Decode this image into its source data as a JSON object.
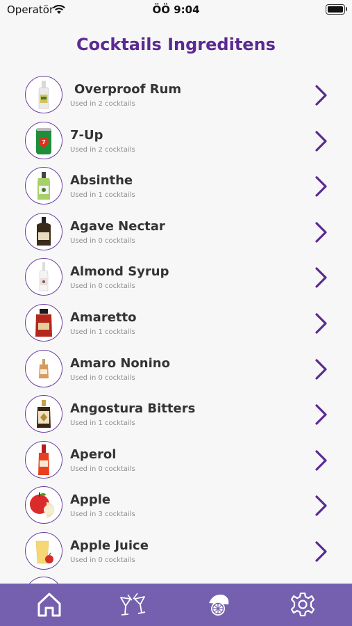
{
  "status_bar": {
    "carrier": "Operatör",
    "time": "ÖÖ 9:04"
  },
  "page": {
    "title": "Cocktails Ingreditens"
  },
  "ingredients": [
    {
      "name": " Overproof Rum",
      "usage": "Used in 2 cocktails",
      "icon": "rum-bottle-icon"
    },
    {
      "name": "7-Up",
      "usage": "Used in 2 cocktails",
      "icon": "soda-can-icon"
    },
    {
      "name": "Absinthe",
      "usage": "Used in 1 cocktails",
      "icon": "absinthe-bottle-icon"
    },
    {
      "name": "Agave Nectar",
      "usage": "Used in 0 cocktails",
      "icon": "agave-bottle-icon"
    },
    {
      "name": "Almond Syrup",
      "usage": "Used in 0 cocktails",
      "icon": "syrup-bottle-icon"
    },
    {
      "name": "Amaretto",
      "usage": "Used in 1 cocktails",
      "icon": "amaretto-bottle-icon"
    },
    {
      "name": "Amaro Nonino",
      "usage": "Used in 0 cocktails",
      "icon": "amaro-bottle-icon"
    },
    {
      "name": "Angostura Bitters",
      "usage": "Used in 1 cocktails",
      "icon": "bitters-bottle-icon"
    },
    {
      "name": "Aperol",
      "usage": "Used in 0 cocktails",
      "icon": "aperol-bottle-icon"
    },
    {
      "name": "Apple",
      "usage": "Used in 3 cocktails",
      "icon": "apple-icon"
    },
    {
      "name": "Apple Juice",
      "usage": "Used in 0 cocktails",
      "icon": "juice-glass-icon"
    }
  ],
  "tab_bar": {
    "tabs": [
      {
        "icon": "home-icon",
        "selected": true
      },
      {
        "icon": "cocktail-glasses-icon",
        "selected": false
      },
      {
        "icon": "lemon-icon",
        "selected": false
      },
      {
        "icon": "settings-gear-icon",
        "selected": false
      }
    ]
  },
  "colors": {
    "accent": "#5b2a92",
    "tab_bar": "#7460ae",
    "background": "#f7f7f7"
  }
}
